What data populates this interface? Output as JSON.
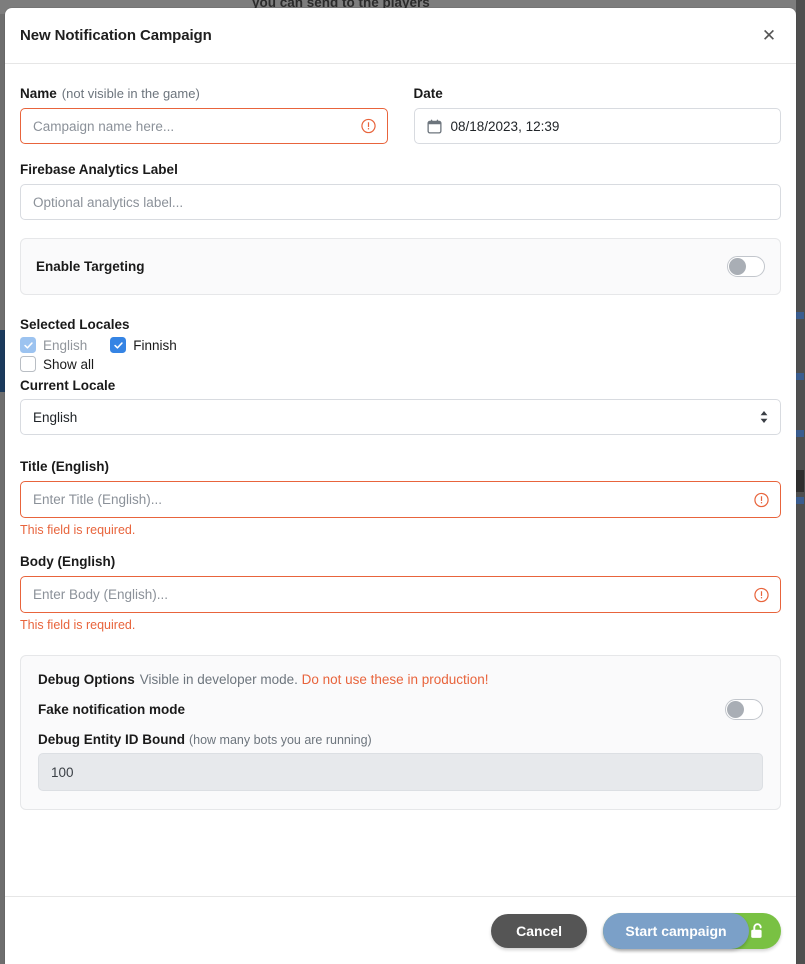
{
  "background": {
    "cut_off_text": "you can send to the players"
  },
  "modal": {
    "title": "New Notification Campaign",
    "close_icon_glyph": "✕",
    "name_field": {
      "label": "Name",
      "hint": "(not visible in the game)",
      "placeholder": "Campaign name here...",
      "value": "",
      "invalid": true,
      "icon": "error-circle-icon"
    },
    "date_field": {
      "label": "Date",
      "value": "08/18/2023, 12:39",
      "icon": "calendar-icon"
    },
    "analytics_field": {
      "label": "Firebase Analytics Label",
      "placeholder": "Optional analytics label...",
      "value": ""
    },
    "targeting": {
      "label": "Enable Targeting",
      "enabled": false
    },
    "locales": {
      "label": "Selected Locales",
      "options": [
        {
          "label": "English",
          "checked": true,
          "disabled": true
        },
        {
          "label": "Finnish",
          "checked": true,
          "disabled": false
        }
      ],
      "show_all": {
        "label": "Show all",
        "checked": false
      },
      "current_locale_label": "Current Locale",
      "current_locale_value": "English"
    },
    "title_field": {
      "label": "Title (English)",
      "placeholder": "Enter Title (English)...",
      "value": "",
      "error": "This field is required."
    },
    "body_field": {
      "label": "Body (English)",
      "placeholder": "Enter Body (English)...",
      "value": "",
      "error": "This field is required."
    },
    "debug": {
      "heading": "Debug Options",
      "note": "Visible in developer mode.",
      "warning": "Do not use these in production!",
      "fake_mode_label": "Fake notification mode",
      "fake_mode_enabled": false,
      "entity_bound_label": "Debug Entity ID Bound",
      "entity_bound_hint": "(how many bots you are running)",
      "entity_bound_value": "100"
    },
    "footer": {
      "cancel_label": "Cancel",
      "start_label": "Start campaign",
      "lock_icon": "unlock-icon"
    }
  },
  "colors": {
    "danger": "#e8643c",
    "accent_blue": "#3584e4",
    "safety_green": "#79c143",
    "primary_button": "#7ba0c8",
    "cancel_button": "#555555"
  }
}
